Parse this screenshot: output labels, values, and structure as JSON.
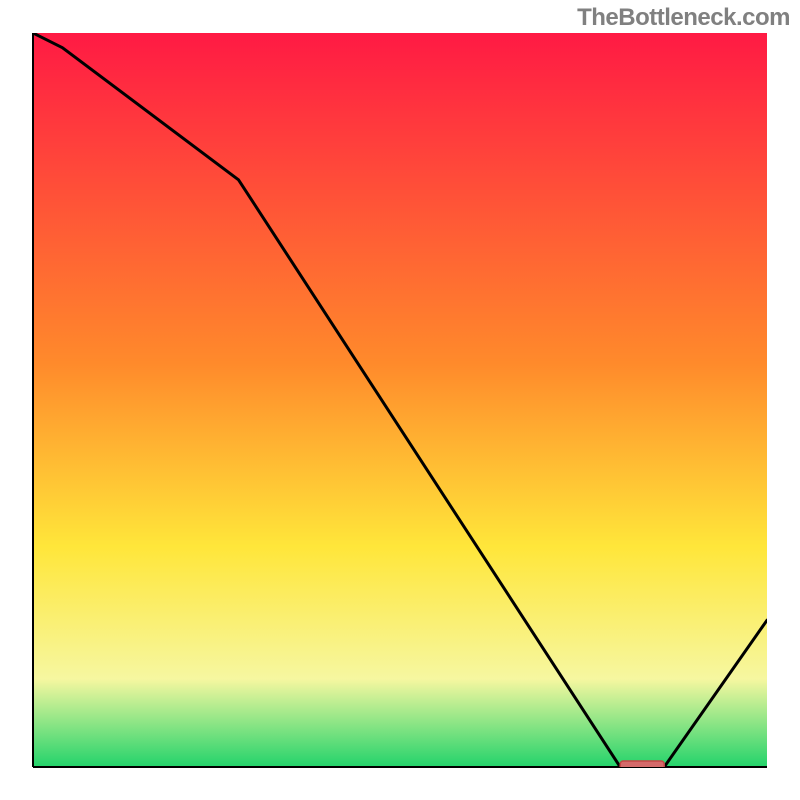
{
  "watermark": "TheBottleneck.com",
  "colors": {
    "gradient_top": "#ff1a44",
    "gradient_mid1": "#ff8a2b",
    "gradient_mid2": "#ffe63a",
    "gradient_mid3": "#f6f7a0",
    "gradient_bottom": "#23d36b",
    "line": "#000000",
    "axis": "#000000",
    "marker_fill": "#d46a6a",
    "marker_stroke": "#c64545"
  },
  "chart_data": {
    "type": "line",
    "title": "",
    "xlabel": "",
    "ylabel": "",
    "xlim": [
      0,
      100
    ],
    "ylim": [
      0,
      100
    ],
    "x": [
      0,
      4,
      28,
      80,
      86,
      100
    ],
    "values": [
      100,
      98,
      80,
      0,
      0,
      20
    ],
    "marker": {
      "x_start": 80,
      "x_end": 86,
      "y": 0
    },
    "annotations": []
  }
}
